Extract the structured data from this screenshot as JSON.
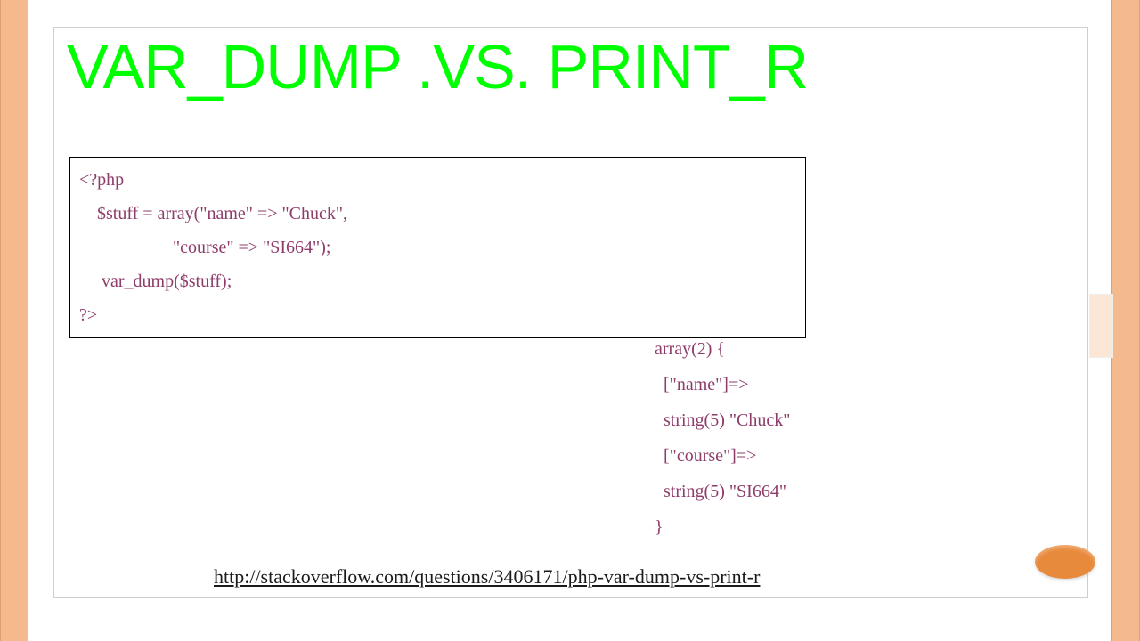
{
  "title": "VAR_DUMP .VS. PRINT_R",
  "code": {
    "l1": "<?php",
    "l2": "    $stuff = array(\"name\" => \"Chuck\",",
    "l3": "                     \"course\" => \"SI664\");",
    "l4": "     var_dump($stuff);",
    "l5": "?>"
  },
  "output": {
    "o1": "array(2) {",
    "o2": "  [\"name\"]=>",
    "o3": "  string(5) \"Chuck\"",
    "o4": "  [\"course\"]=>",
    "o5": "  string(5) \"SI664\"",
    "o6": "}"
  },
  "link": "http://stackoverflow.com/questions/3406171/php-var-dump-vs-print-r"
}
